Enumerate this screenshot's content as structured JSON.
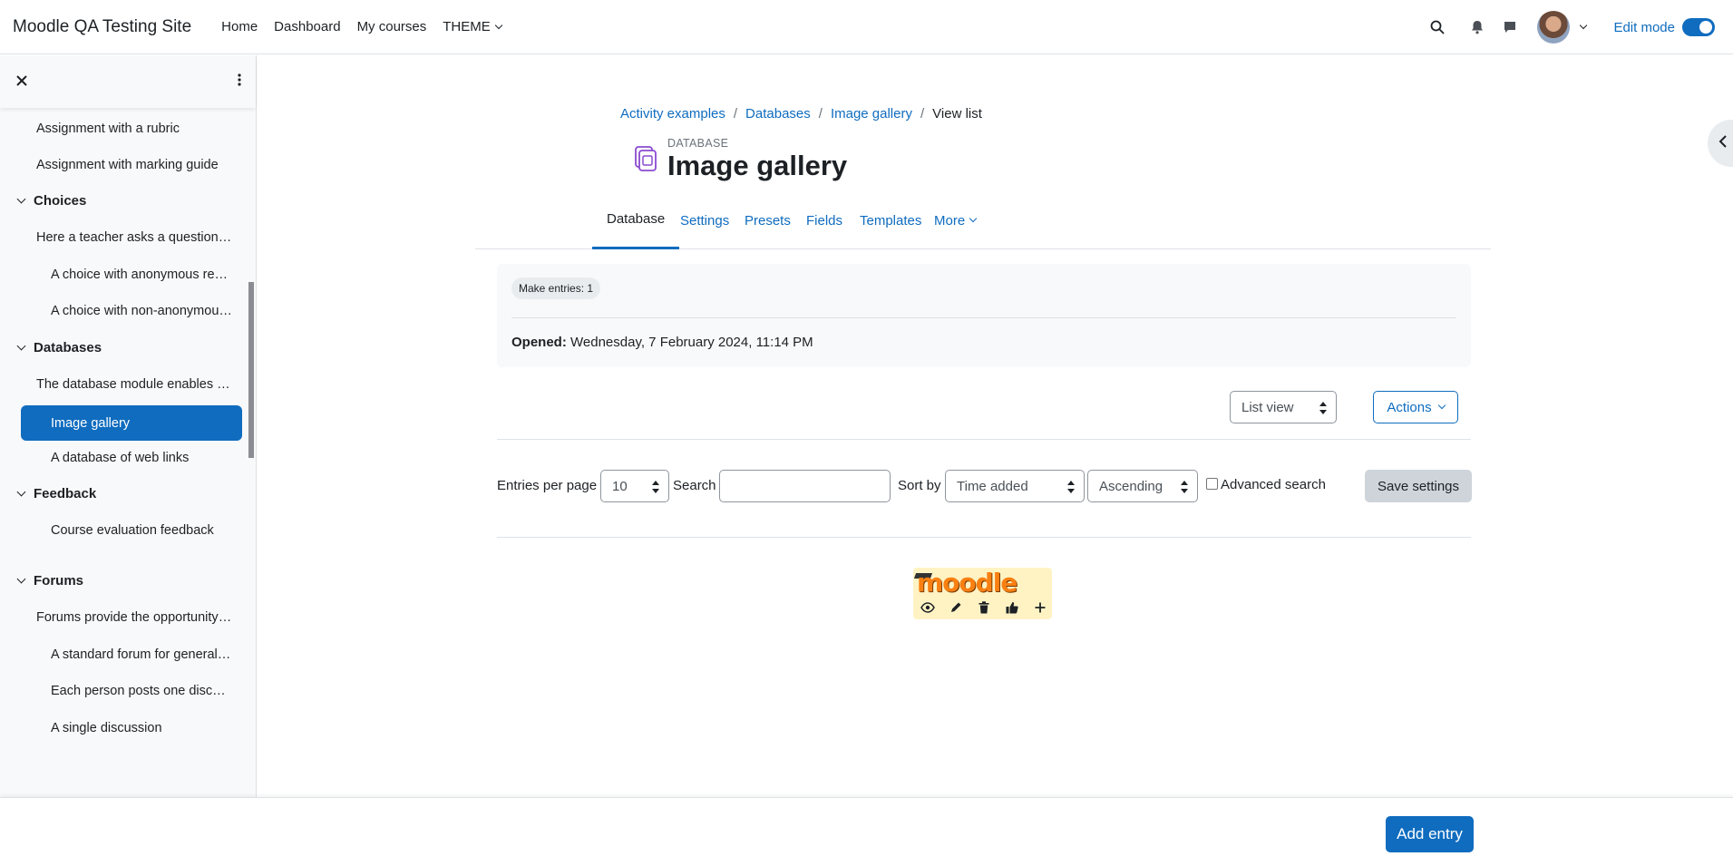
{
  "navbar": {
    "brand": "Moodle QA Testing Site",
    "links": [
      "Home",
      "Dashboard",
      "My courses",
      "THEME"
    ],
    "edit_mode_label": "Edit mode"
  },
  "drawer": {
    "items": [
      {
        "kind": "item",
        "label": "Assignment with a rubric"
      },
      {
        "kind": "item",
        "label": "Assignment with marking guide"
      },
      {
        "kind": "section",
        "label": "Choices"
      },
      {
        "kind": "item",
        "label": "Here a teacher asks a question and specifies a choice of multiple responses."
      },
      {
        "kind": "sub",
        "label": "A choice with anonymous results"
      },
      {
        "kind": "sub",
        "label": "A choice with non-anonymous results"
      },
      {
        "kind": "section",
        "label": "Databases"
      },
      {
        "kind": "item",
        "label": "The database module enables participants to create, maintain and search a bank of entries"
      },
      {
        "kind": "active",
        "label": "Image gallery"
      },
      {
        "kind": "sub",
        "label": "A database of web links"
      },
      {
        "kind": "section",
        "label": "Feedback"
      },
      {
        "kind": "sub",
        "label": "Course evaluation feedback"
      },
      {
        "kind": "section",
        "label": "Forums"
      },
      {
        "kind": "item",
        "label": "Forums provide the opportunity for discussion"
      },
      {
        "kind": "sub",
        "label": "A standard forum for general use"
      },
      {
        "kind": "sub",
        "label": "Each person posts one discussion"
      },
      {
        "kind": "sub",
        "label": "A single discussion"
      }
    ]
  },
  "breadcrumb": [
    "Activity examples",
    "Databases",
    "Image gallery",
    "View list"
  ],
  "header": {
    "activity_type": "DATABASE",
    "title": "Image gallery"
  },
  "tabs": [
    "Database",
    "Settings",
    "Presets",
    "Fields",
    "Templates",
    "More"
  ],
  "info": {
    "badge": "Make entries: 1",
    "opened_label": "Opened:",
    "opened_value": "Wednesday, 7 February 2024, 11:14 PM"
  },
  "view_select": "List view",
  "actions_label": "Actions",
  "filters": {
    "entries_per_page_label": "Entries per page",
    "entries_per_page_value": "10",
    "search_label": "Search",
    "search_value": "",
    "sort_by_label": "Sort by",
    "sort_by_value": "Time added",
    "order_value": "Ascending",
    "advanced_search_label": "Advanced search",
    "save_label": "Save settings"
  },
  "entry": {
    "logo_text": "moodle"
  },
  "help_label": "?",
  "add_entry_label": "Add entry",
  "colors": {
    "accent": "#0f6cbf",
    "entry_bg": "#fff3c4",
    "logo": "#f98012"
  }
}
